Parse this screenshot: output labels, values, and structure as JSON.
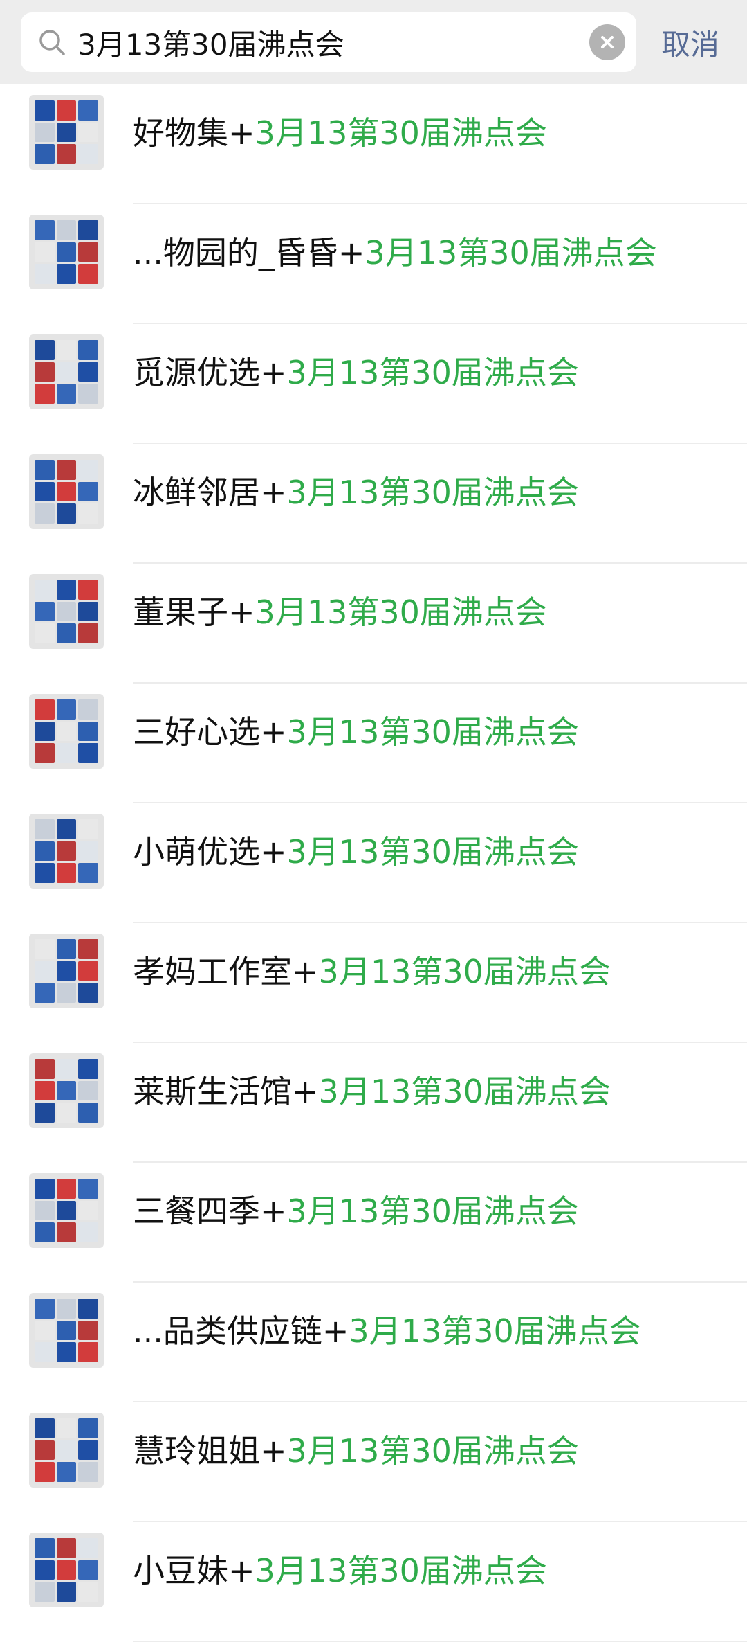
{
  "search": {
    "query": "3月13第30届沸点会",
    "cancel_label": "取消"
  },
  "keyword": "3月13第30届沸点会",
  "colors": {
    "highlight": "#2fab4a",
    "cancel": "#576b95",
    "search_bg": "#ededed",
    "thumb_tiles": [
      "#1f4fa5",
      "#d23c3c",
      "#3567b8",
      "#c8cfd9",
      "#1e4a9a",
      "#e8e8e8",
      "#2d5fb0",
      "#b83a3a",
      "#dfe4ea"
    ]
  },
  "results": [
    {
      "name": "好物集",
      "sep": "+"
    },
    {
      "name": "...物园的_昏昏",
      "sep": "+"
    },
    {
      "name": "觅源优选",
      "sep": "+"
    },
    {
      "name": "冰鲜邻居",
      "sep": "+"
    },
    {
      "name": "董果子",
      "sep": "+"
    },
    {
      "name": "三好心选",
      "sep": "+"
    },
    {
      "name": "小萌优选",
      "sep": "+"
    },
    {
      "name": "孝妈工作室",
      "sep": "+"
    },
    {
      "name": "莱斯生活馆",
      "sep": "+"
    },
    {
      "name": "三餐四季",
      "sep": "+"
    },
    {
      "name": "...品类供应链",
      "sep": "+"
    },
    {
      "name": "慧玲姐姐",
      "sep": "+"
    },
    {
      "name": "小豆妹",
      "sep": "+"
    }
  ]
}
